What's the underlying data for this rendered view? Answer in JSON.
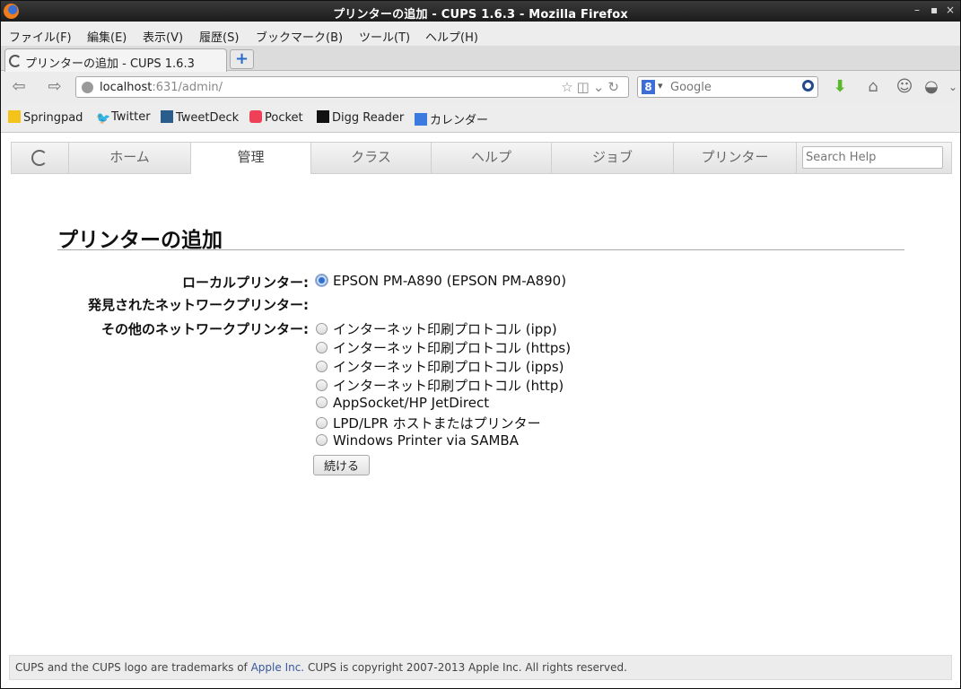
{
  "window": {
    "title": "プリンターの追加 - CUPS 1.6.3 - Mozilla Firefox",
    "controls": [
      "–",
      "▪",
      "×"
    ]
  },
  "menubar": {
    "items": [
      "ファイル(F)",
      "編集(E)",
      "表示(V)",
      "履歴(S)",
      "ブックマーク(B)",
      "ツール(T)",
      "ヘルプ(H)"
    ]
  },
  "tab": {
    "label": "プリンターの追加  -  CUPS 1.6.3",
    "new_tab": "+"
  },
  "navbar": {
    "url_host": "localhost",
    "url_path": ":631/admin/",
    "search_engine_letter": "8",
    "search_placeholder": "Google"
  },
  "bookmarks": [
    "Springpad",
    "Twitter",
    "TweetDeck",
    "Pocket",
    "Digg Reader",
    "カレンダー"
  ],
  "cups": {
    "nav": [
      "ホーム",
      "管理",
      "クラス",
      "ヘルプ",
      "ジョブ",
      "プリンター"
    ],
    "active_nav": "管理",
    "search_placeholder": "Search Help"
  },
  "page": {
    "heading": "プリンターの追加",
    "local_label": "ローカルプリンター:",
    "local_options": [
      "EPSON PM-A890 (EPSON PM-A890)"
    ],
    "discovered_label": "発見されたネットワークプリンター:",
    "other_label": "その他のネットワークプリンター:",
    "other_options": [
      "インターネット印刷プロトコル (ipp)",
      "インターネット印刷プロトコル (https)",
      "インターネット印刷プロトコル (ipps)",
      "インターネット印刷プロトコル (http)",
      "AppSocket/HP JetDirect",
      "LPD/LPR ホストまたはプリンター",
      "Windows Printer via SAMBA"
    ],
    "continue_button": "続ける"
  },
  "footer": {
    "prefix": "CUPS and the CUPS logo are trademarks of ",
    "link": "Apple Inc.",
    "suffix": " CUPS is copyright 2007-2013 Apple Inc. All rights reserved."
  }
}
